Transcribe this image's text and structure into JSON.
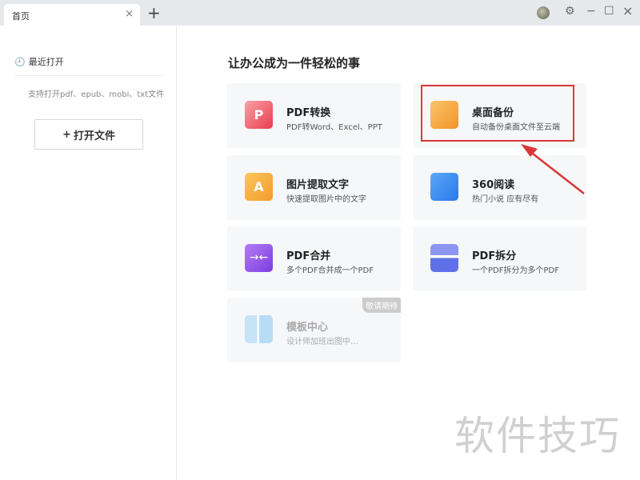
{
  "tabs": [
    {
      "label": "首页",
      "close": "×"
    }
  ],
  "new_tab": "+",
  "window_controls": {
    "settings": "⚙",
    "minimize": "−",
    "maximize": "☐",
    "close": "×"
  },
  "sidebar": {
    "recent_label": "最近打开",
    "hint": "支持打开pdf、epub、mobi、txt文件",
    "open_button": "打开文件"
  },
  "main": {
    "title": "让办公成为一件轻松的事",
    "cards": [
      {
        "name": "PDF转换",
        "desc": "PDF转Word、Excel、PPT",
        "icon": "P"
      },
      {
        "name": "桌面备份",
        "desc": "自动备份桌面文件至云端"
      },
      {
        "name": "图片提取文字",
        "desc": "快速提取图片中的文字",
        "icon": "A"
      },
      {
        "name": "360阅读",
        "desc": "热门小说 应有尽有"
      },
      {
        "name": "PDF合并",
        "desc": "多个PDF合并成一个PDF"
      },
      {
        "name": "PDF拆分",
        "desc": "一个PDF拆分为多个PDF"
      },
      {
        "name": "模板中心",
        "desc": "设计师加班出图中…",
        "badge": "敬请期待"
      }
    ]
  },
  "watermark": "软件技巧",
  "colors": {
    "highlight": "#d9383a"
  }
}
